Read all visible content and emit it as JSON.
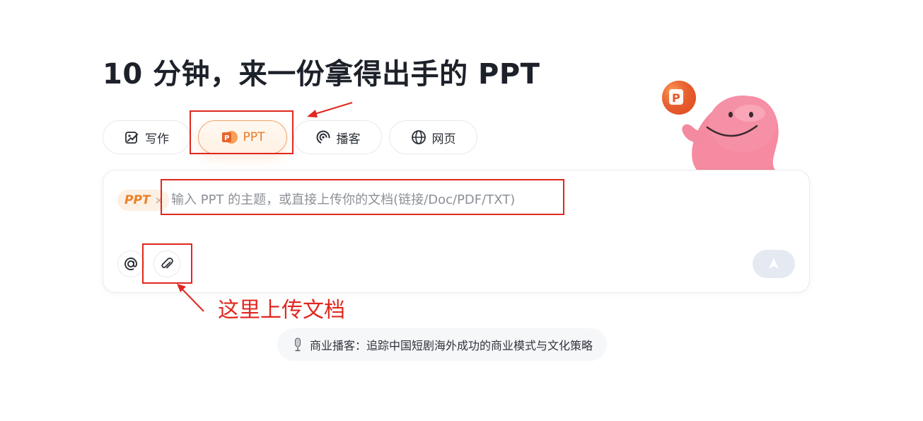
{
  "headline": "10 分钟，来一份拿得出手的 PPT",
  "tabs": [
    {
      "label": "写作",
      "icon": "writing-icon",
      "active": false
    },
    {
      "label": "PPT",
      "icon": "ppt-icon",
      "active": true
    },
    {
      "label": "播客",
      "icon": "podcast-icon",
      "active": false
    },
    {
      "label": "网页",
      "icon": "globe-icon",
      "active": false
    }
  ],
  "composer": {
    "chip_label": "PPT",
    "chip_close": "×",
    "placeholder": "输入 PPT 的主题，或直接上传你的文档(链接/Doc/PDF/TXT)",
    "value": "",
    "buttons": [
      {
        "icon": "at-icon",
        "label": "@"
      },
      {
        "icon": "paperclip-icon",
        "label": "attach"
      },
      {
        "icon": "send-icon",
        "label": "send"
      }
    ]
  },
  "annotation": {
    "text": "这里上传文档",
    "color": "#e0281f"
  },
  "suggestion": {
    "icon": "microphone-icon",
    "text": "商业播客：追踪中国短剧海外成功的商业模式与文化策略"
  },
  "mascot": {
    "badge": "P"
  },
  "colors": {
    "accent": "#ea7a22",
    "annotation": "#e0281f",
    "mascot": "#f58aa0"
  }
}
